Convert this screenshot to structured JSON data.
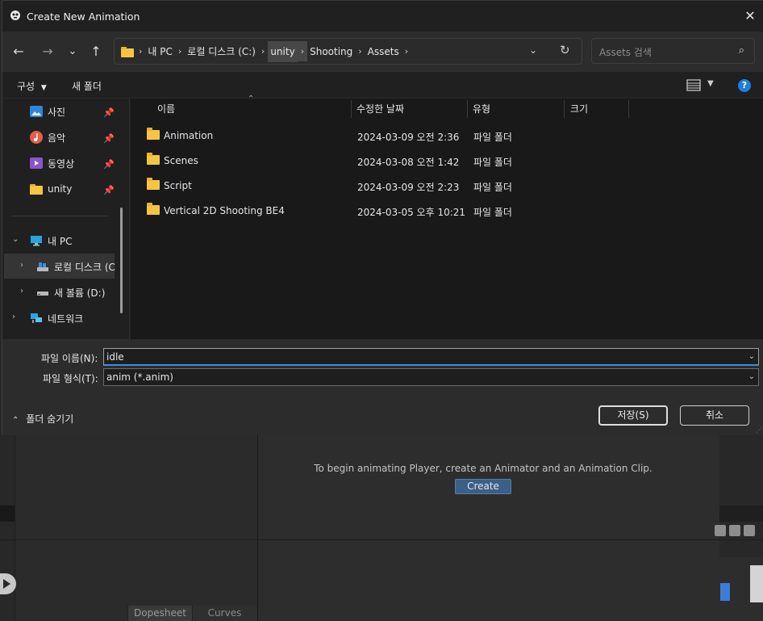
{
  "dialog": {
    "title": "Create New Animation",
    "close_glyph": "✕"
  },
  "nav": {
    "back": "←",
    "forward": "→",
    "recent": "⌄",
    "up": "↑",
    "breadcrumbs": [
      "내 PC",
      "로컬 디스크 (C:)",
      "unity",
      "Shooting",
      "Assets"
    ],
    "dropdown": "⌄",
    "refresh": "↻",
    "search_placeholder": "Assets 검색",
    "search_icon": "⌕"
  },
  "toolbar": {
    "organize": "구성",
    "new_folder": "새 폴더",
    "help": "?"
  },
  "sidebar": {
    "quick": [
      {
        "label": "사진",
        "icon": "pictures-icon",
        "pinned": true
      },
      {
        "label": "음악",
        "icon": "music-icon",
        "pinned": true
      },
      {
        "label": "동영상",
        "icon": "videos-icon",
        "pinned": true
      },
      {
        "label": "unity",
        "icon": "folder-icon",
        "pinned": true
      }
    ],
    "this_pc": "내 PC",
    "local_disk": "로컬 디스크 (C",
    "new_volume": "새 볼륨 (D:)",
    "network": "네트워크"
  },
  "filelist": {
    "columns": [
      "이름",
      "수정한 날짜",
      "유형",
      "크기"
    ],
    "rows": [
      {
        "name": "Animation",
        "date": "2024-03-09 오전 2:36",
        "type": "파일 폴더",
        "size": ""
      },
      {
        "name": "Scenes",
        "date": "2024-03-08 오전 1:42",
        "type": "파일 폴더",
        "size": ""
      },
      {
        "name": "Script",
        "date": "2024-03-09 오전 2:23",
        "type": "파일 폴더",
        "size": ""
      },
      {
        "name": "Vertical 2D Shooting BE4",
        "date": "2024-03-05 오후 10:21",
        "type": "파일 폴더",
        "size": ""
      }
    ]
  },
  "form": {
    "filename_label": "파일 이름(N):",
    "filename_value": "idle",
    "filetype_label": "파일 형식(T):",
    "filetype_value": "anim (*.anim)",
    "save_label": "저장(S)",
    "cancel_label": "취소",
    "hide_folders_label": "폴더 숨기기"
  },
  "unity": {
    "message": "To begin animating Player, create an Animator and an Animation Clip.",
    "create_label": "Create",
    "tabs": [
      "Dopesheet",
      "Curves"
    ]
  }
}
